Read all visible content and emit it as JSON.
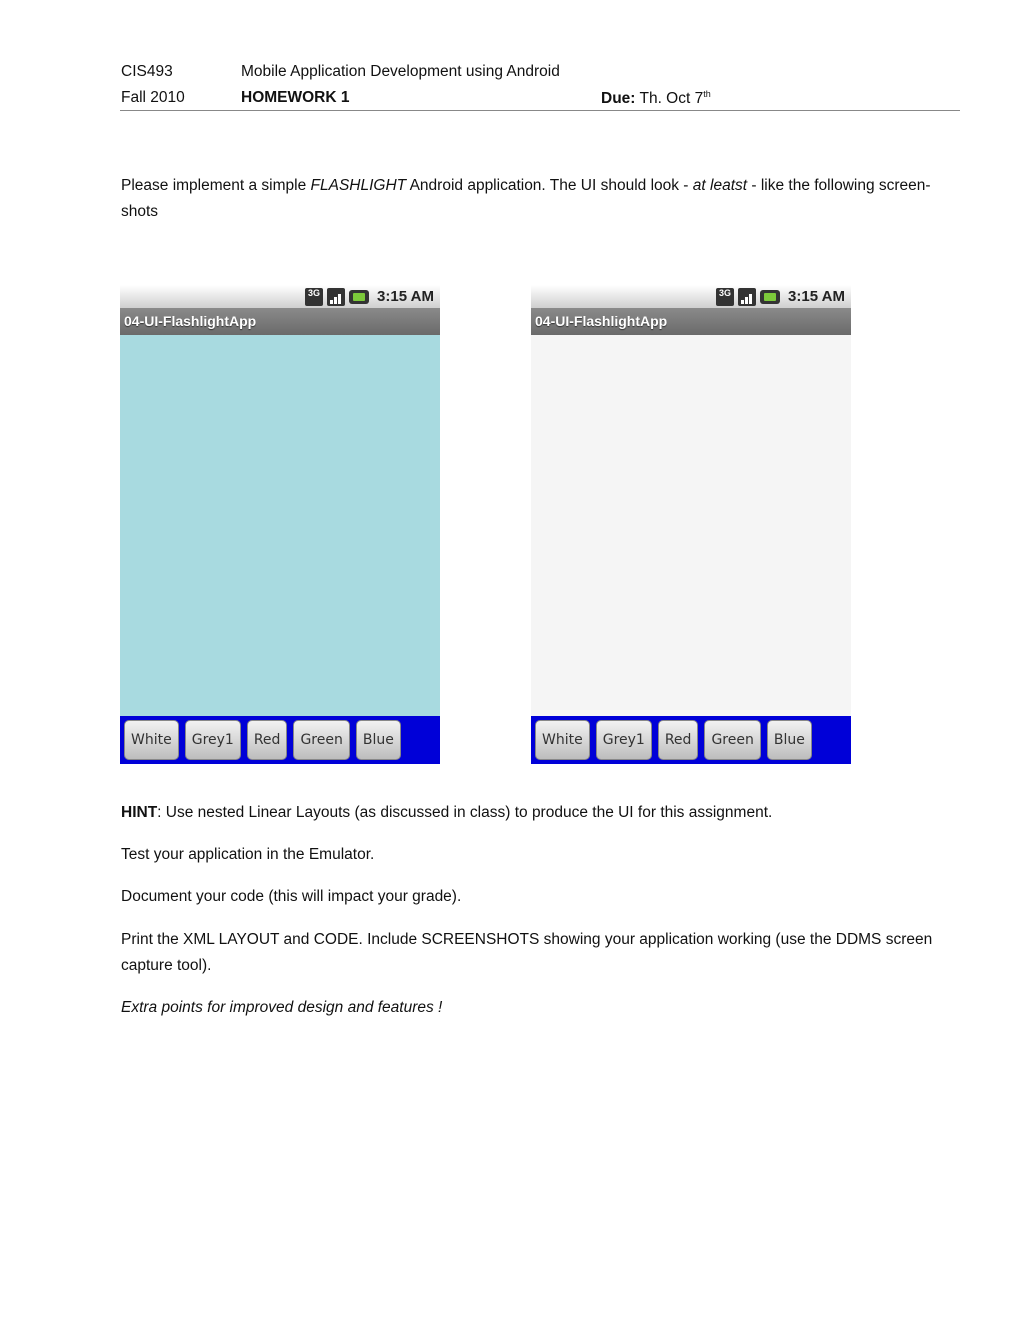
{
  "header": {
    "course": "CIS493",
    "course_title": "Mobile Application Development using Android",
    "term": "Fall 2010",
    "assignment": "HOMEWORK 1",
    "due_label": "Due:",
    "due_value": " Th. Oct 7",
    "due_sup": "th"
  },
  "intro": {
    "t1": "Please implement a simple ",
    "t2": "FLASHLIGHT",
    "t3": " Android application. The UI should look - ",
    "t4": "at leatst",
    "t5": " - like the following screen-shots"
  },
  "screenshots": [
    {
      "status_time": "3:15 AM",
      "network": "3G",
      "app_title": "04-UI-FlashlightApp",
      "canvas_color": "#a8dae0",
      "buttons": [
        "White",
        "Grey1",
        "Red",
        "Green",
        "Blue"
      ]
    },
    {
      "status_time": "3:15 AM",
      "network": "3G",
      "app_title": "04-UI-FlashlightApp",
      "canvas_color": "#f5f5f5",
      "buttons": [
        "White",
        "Grey1",
        "Red",
        "Green",
        "Blue"
      ]
    }
  ],
  "button_bar_color": "#0000d8",
  "body": {
    "hint_label": "HINT",
    "hint_text": ": Use nested Linear Layouts (as discussed in class) to produce the UI for this assignment.",
    "test": "Test your application in the Emulator.",
    "document": "Document your code (this will impact your grade).",
    "print": "Print the XML LAYOUT and CODE. Include SCREENSHOTS showing your application working (use the DDMS screen capture tool).",
    "extra": "Extra points for improved design and features !"
  }
}
